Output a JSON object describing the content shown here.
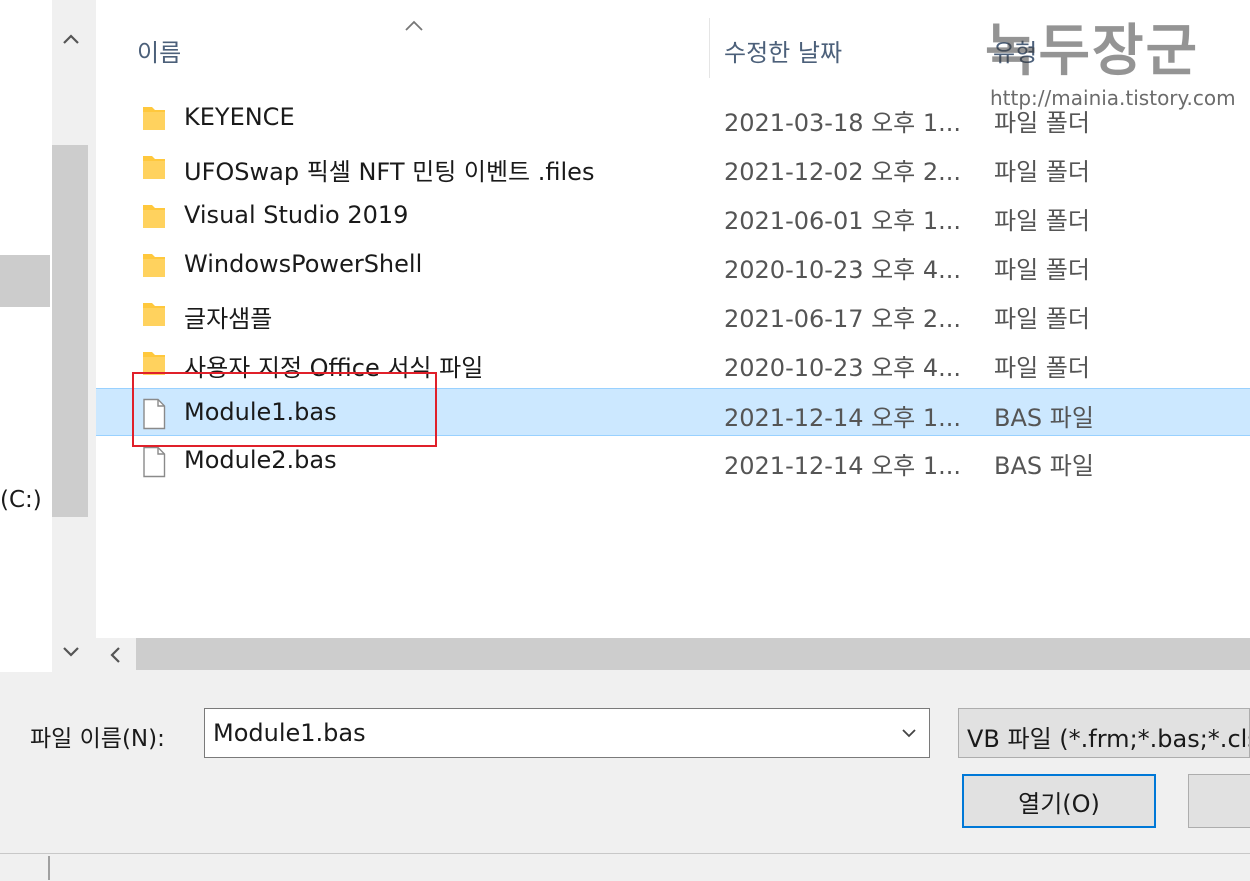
{
  "nav": {
    "drive_label": "(C:)"
  },
  "columns": {
    "name": "이름",
    "date": "수정한 날짜",
    "type": "유형"
  },
  "files": [
    {
      "name": "KEYENCE",
      "date": "2021-03-18 오후 1...",
      "type": "파일 폴더",
      "icon": "folder-icon",
      "selected": false
    },
    {
      "name": "UFOSwap 픽셀 NFT 민팅 이벤트 .files",
      "date": "2021-12-02 오후 2...",
      "type": "파일 폴더",
      "icon": "folder-icon",
      "selected": false
    },
    {
      "name": "Visual Studio 2019",
      "date": "2021-06-01 오후 1...",
      "type": "파일 폴더",
      "icon": "folder-icon",
      "selected": false
    },
    {
      "name": "WindowsPowerShell",
      "date": "2020-10-23 오후 4...",
      "type": "파일 폴더",
      "icon": "folder-icon",
      "selected": false
    },
    {
      "name": "글자샘플",
      "date": "2021-06-17 오후 2...",
      "type": "파일 폴더",
      "icon": "folder-icon",
      "selected": false
    },
    {
      "name": "사용자 지정 Office 서식 파일",
      "date": "2020-10-23 오후 4...",
      "type": "파일 폴더",
      "icon": "folder-icon",
      "selected": false
    },
    {
      "name": "Module1.bas",
      "date": "2021-12-14 오후 1...",
      "type": "BAS 파일",
      "icon": "file-icon",
      "selected": true
    },
    {
      "name": "Module2.bas",
      "date": "2021-12-14 오후 1...",
      "type": "BAS 파일",
      "icon": "file-icon",
      "selected": false
    }
  ],
  "watermark": {
    "title": "녹두장군",
    "url": "http://mainia.tistory.com"
  },
  "bottom": {
    "filename_label": "파일 이름(N):",
    "filename_value": "Module1.bas",
    "filetype_value": "VB 파일 (*.frm;*.bas;*.cls",
    "open_label": "열기(O)"
  },
  "colors": {
    "selection": "#cce8ff",
    "selection_border": "#99d1ff",
    "folder": "#ffc83d",
    "highlight_box": "#e0202a",
    "accent": "#0078d7"
  }
}
